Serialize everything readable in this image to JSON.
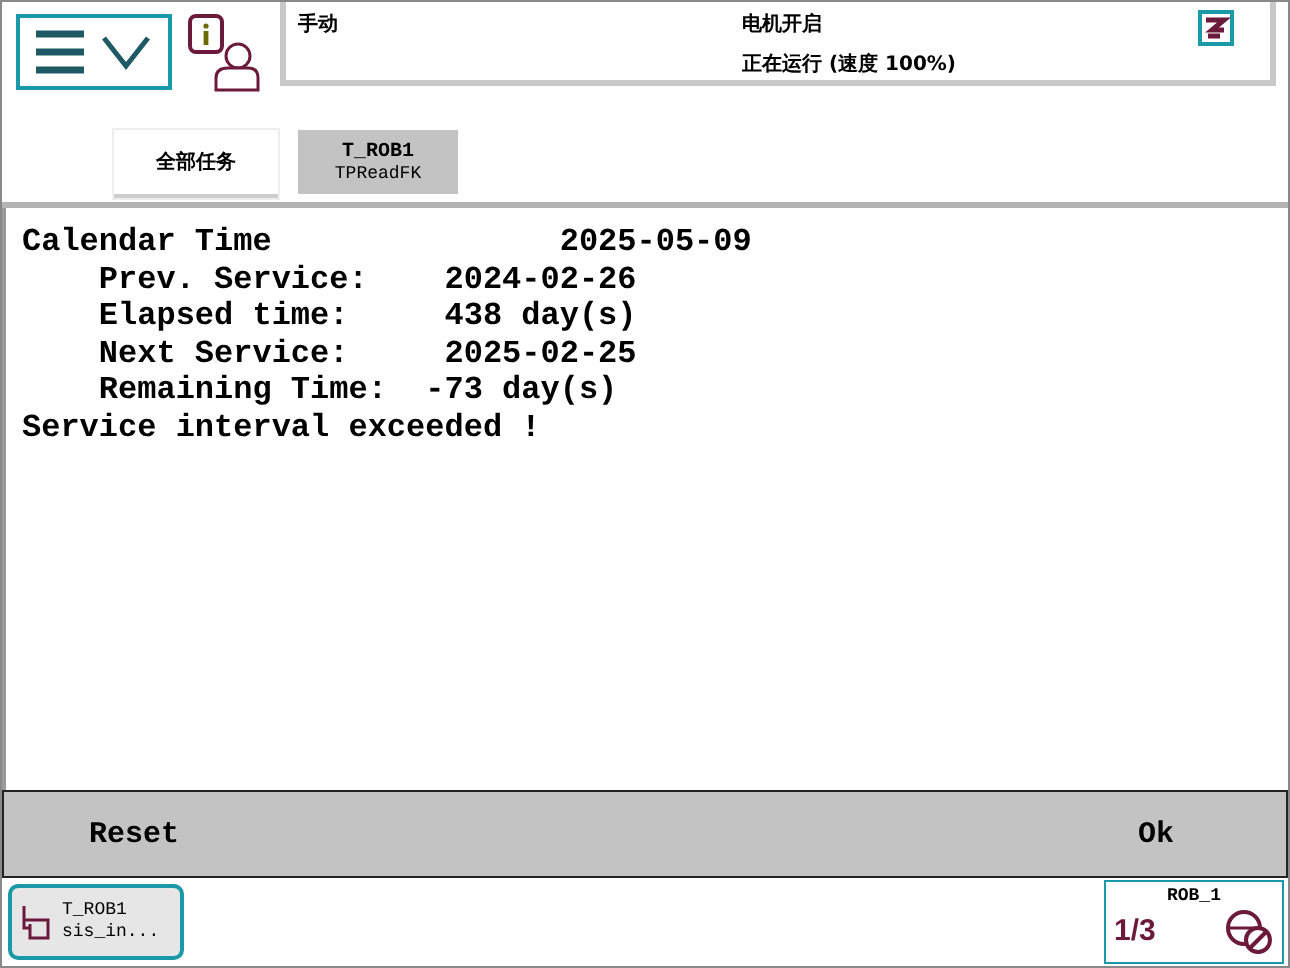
{
  "header": {
    "mode": "手动",
    "motor": "电机开启",
    "run_state": "正在运行 (速度 100%)"
  },
  "tabs": [
    {
      "label": "全部任务",
      "selected": false
    },
    {
      "label": "T_ROB1",
      "sublabel": "TPReadFK",
      "selected": true
    }
  ],
  "content": {
    "lines": [
      "Calendar Time               2025-05-09",
      "    Prev. Service:    2024-02-26",
      "    Elapsed time:     438 day(s)",
      "    Next Service:     2025-02-25",
      "    Remaining Time:  -73 day(s)",
      "Service interval exceeded !"
    ]
  },
  "buttons": [
    {
      "label": "Reset"
    },
    {
      "label": "Ok"
    }
  ],
  "taskbar": {
    "task": {
      "title": "T_ROB1",
      "subtitle": "sis_in..."
    },
    "robot": {
      "name": "ROB_1",
      "fraction": "1/3"
    }
  }
}
